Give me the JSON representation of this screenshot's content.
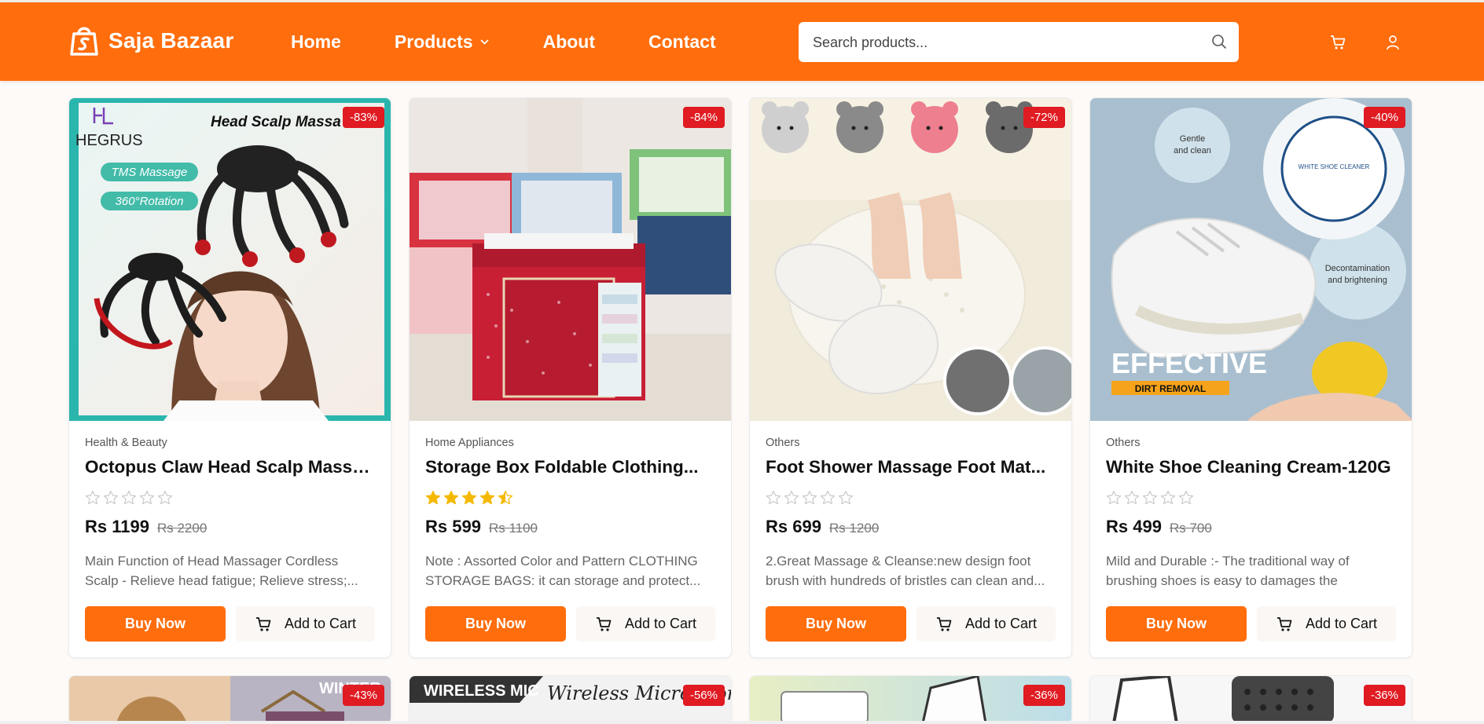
{
  "header": {
    "brand": "Saja Bazaar",
    "nav": [
      {
        "label": "Home"
      },
      {
        "label": "Products",
        "has_dropdown": true
      },
      {
        "label": "About"
      },
      {
        "label": "Contact"
      }
    ],
    "search_placeholder": "Search products...",
    "accent_color": "#ff6d0c"
  },
  "products": [
    {
      "category": "Health & Beauty",
      "title": "Octopus Claw Head Scalp Massager",
      "rating": 0,
      "price": "Rs 1199",
      "old_price": "Rs 2200",
      "discount": "-83%",
      "description": "Main Function of Head Massager Cordless Scalp - Relieve head fatigue; Relieve stress;...",
      "image_text": [
        "HEGRUS",
        "Head Scalp Massa",
        "TMS Massage",
        "360°Rotation"
      ]
    },
    {
      "category": "Home Appliances",
      "title": "Storage Box Foldable Clothing...",
      "rating": 4.5,
      "price": "Rs 599",
      "old_price": "Rs 1100",
      "discount": "-84%",
      "description": "Note : Assorted Color and Pattern CLOTHING STORAGE BAGS: it can storage and protect...",
      "image_text": []
    },
    {
      "category": "Others",
      "title": "Foot Shower Massage Foot Mat...",
      "rating": 0,
      "price": "Rs 699",
      "old_price": "Rs 1200",
      "discount": "-72%",
      "description": "2.Great Massage & Cleanse:new design foot brush with hundreds of bristles can clean and...",
      "image_text": []
    },
    {
      "category": "Others",
      "title": "White Shoe Cleaning Cream-120G",
      "rating": 0,
      "price": "Rs 499",
      "old_price": "Rs 700",
      "discount": "-40%",
      "description": "Mild and Durable :- The traditional way of brushing shoes is easy to damages the surface...",
      "image_text": [
        "Gentle and clean",
        "Decontamination and brightening",
        "EFFECTIVE",
        "DIRT REMOVAL"
      ]
    }
  ],
  "products_row2": [
    {
      "discount": "-43%",
      "image_text": [
        "WINTER"
      ]
    },
    {
      "discount": "-56%",
      "image_text": [
        "WIRELESS MIC",
        "Wireless Microphon"
      ]
    },
    {
      "discount": "-36%",
      "image_text": []
    },
    {
      "discount": "-36%",
      "image_text": []
    }
  ],
  "buttons": {
    "buy_now": "Buy Now",
    "add_to_cart": "Add to Cart"
  },
  "colors": {
    "accent": "#ff6d0c",
    "badge": "#e01b22",
    "star": "#f5b800"
  }
}
